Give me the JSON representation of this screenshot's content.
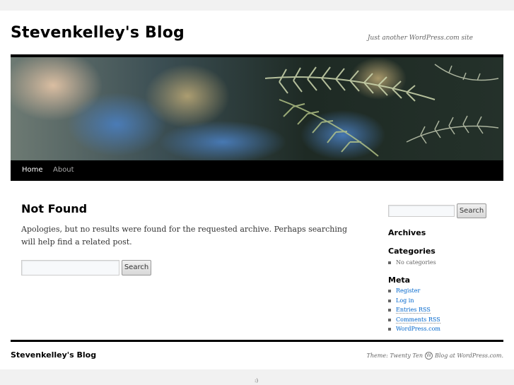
{
  "site": {
    "title": "Stevenkelley's Blog",
    "description": "Just another WordPress.com site"
  },
  "nav": {
    "items": [
      {
        "label": "Home"
      },
      {
        "label": "About"
      }
    ]
  },
  "content": {
    "title": "Not Found",
    "text": "Apologies, but no results were found for the requested archive. Perhaps searching will help find a related post.",
    "search": {
      "value": "",
      "button_label": "Search"
    }
  },
  "sidebar": {
    "search": {
      "value": "",
      "button_label": "Search"
    },
    "archives": {
      "title": "Archives"
    },
    "categories": {
      "title": "Categories",
      "items": [
        "No categories"
      ]
    },
    "meta": {
      "title": "Meta",
      "items": [
        "Register",
        "Log in",
        "Entries RSS",
        "Comments RSS",
        "WordPress.com"
      ]
    }
  },
  "footer": {
    "title": "Stevenkelley's Blog",
    "theme_text": "Theme: Twenty Ten",
    "blog_text": "Blog at WordPress.com."
  },
  "smiley": ":)",
  "colors": {
    "link": "#0066cc",
    "nav_background": "#000000",
    "page_background": "#f1f1f1"
  }
}
